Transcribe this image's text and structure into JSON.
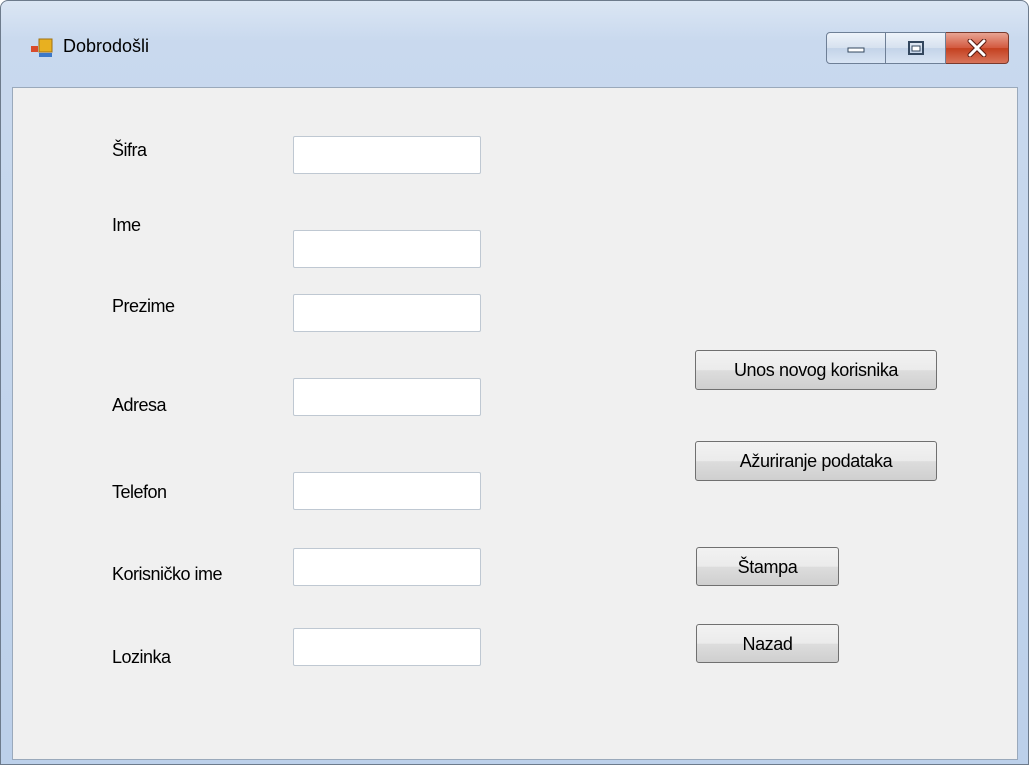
{
  "window": {
    "title": "Dobrodošli"
  },
  "form": {
    "labels": {
      "sifra": "Šifra",
      "ime": "Ime",
      "prezime": "Prezime",
      "adresa": "Adresa",
      "telefon": "Telefon",
      "korisnicko_ime": "Korisničko ime",
      "lozinka": "Lozinka"
    },
    "values": {
      "sifra": "",
      "ime": "",
      "prezime": "",
      "adresa": "",
      "telefon": "",
      "korisnicko_ime": "",
      "lozinka": ""
    }
  },
  "buttons": {
    "unos": "Unos novog korisnika",
    "azuriranje": "Ažuriranje podataka",
    "stampa": "Štampa",
    "nazad": "Nazad"
  },
  "colors": {
    "close_button": "#c4401f",
    "client_bg": "#f0f0f0"
  },
  "icons": [
    "app-window-icon",
    "minimize-icon",
    "maximize-icon",
    "close-icon"
  ]
}
